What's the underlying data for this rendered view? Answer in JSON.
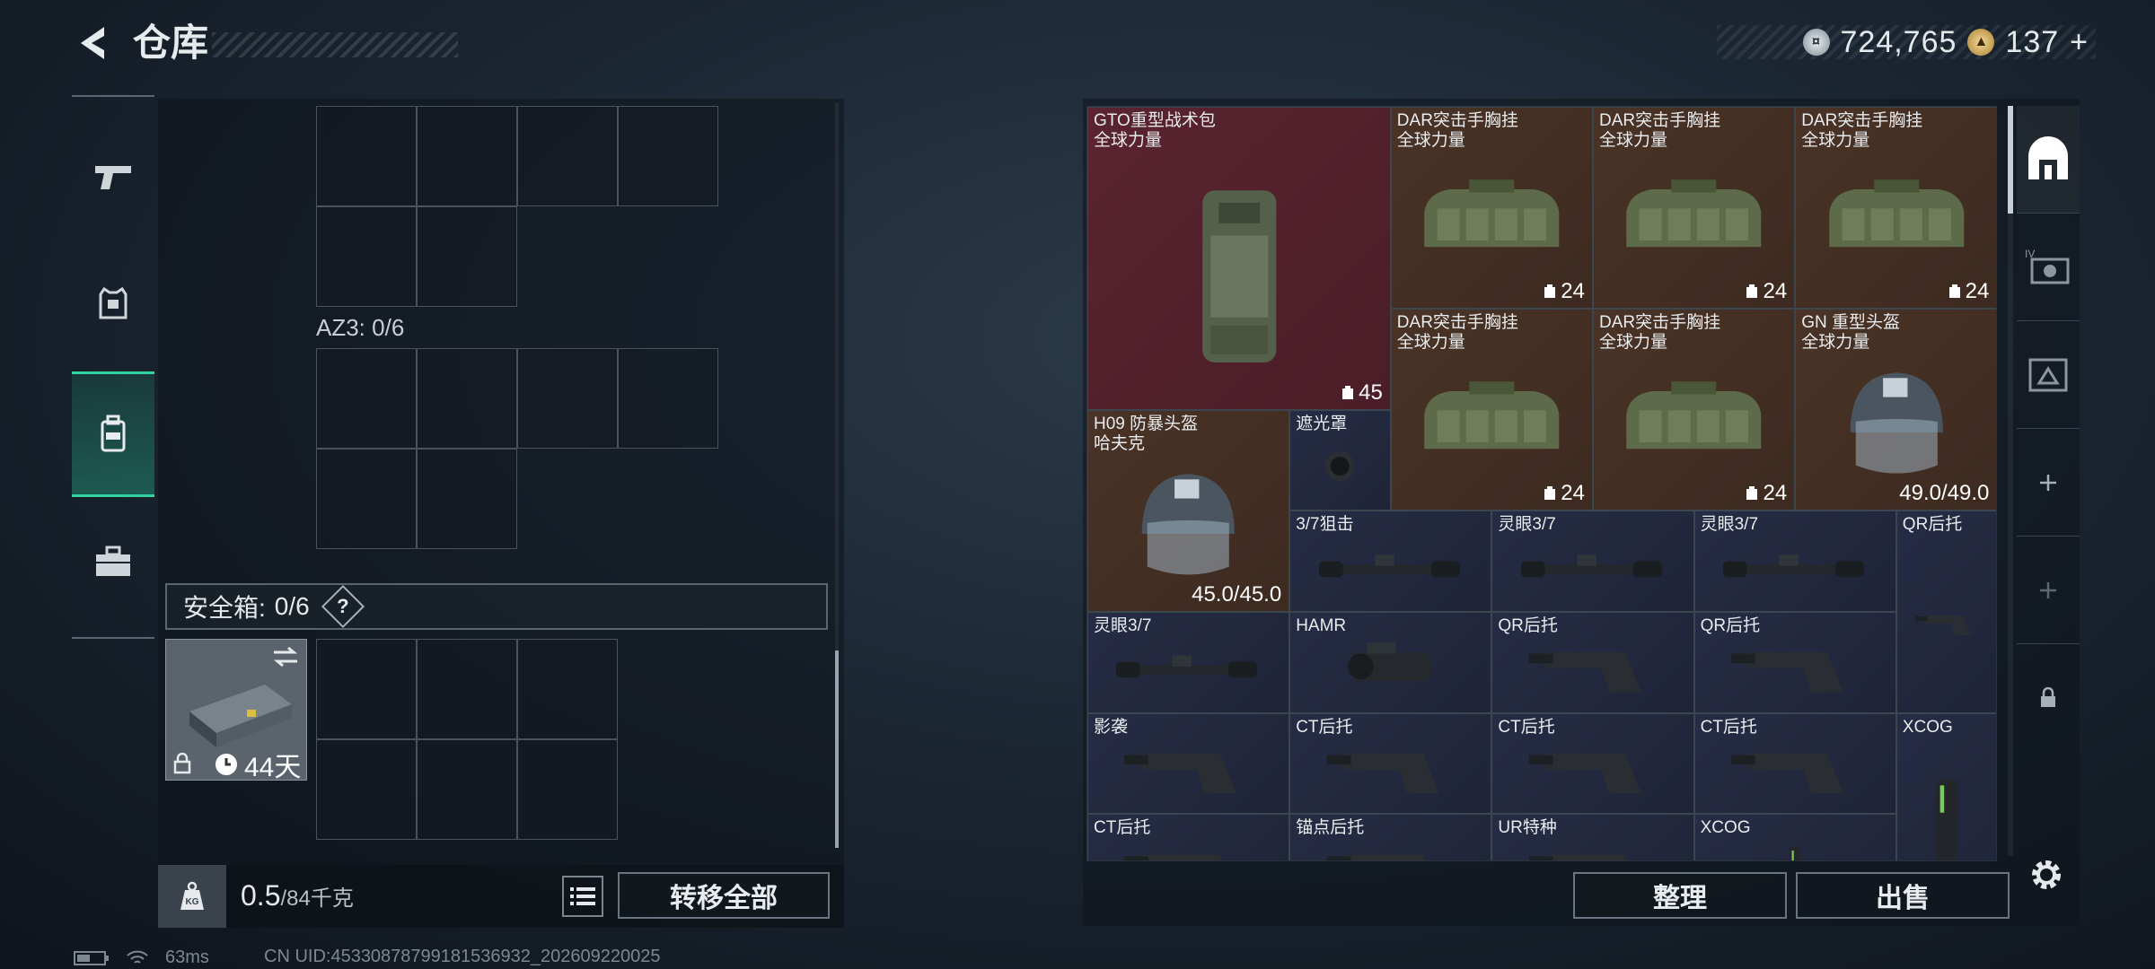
{
  "header": {
    "title": "仓库"
  },
  "currency": {
    "silver": "724,765",
    "gold": "137",
    "gold_plus": "+"
  },
  "nav": {
    "items": [
      "weapons",
      "armor",
      "backpack",
      "briefcase"
    ],
    "active": 2
  },
  "left_panel": {
    "az3_label": "AZ3: 0/6",
    "safe_box": {
      "label": "安全箱:",
      "value": "0/6",
      "help": "?",
      "days": "44天"
    },
    "weight": {
      "value": "0.5",
      "max": "/84千克"
    },
    "transfer_all": "转移全部"
  },
  "inventory": {
    "items": [
      {
        "name": "GTO重型战术包\n全球力量",
        "count": "45",
        "color": "red"
      },
      {
        "name": "DAR突击手胸挂\n全球力量",
        "count": "24",
        "color": "brown"
      },
      {
        "name": "DAR突击手胸挂\n全球力量",
        "count": "24",
        "color": "brown"
      },
      {
        "name": "DAR突击手胸挂\n全球力量",
        "count": "24",
        "color": "brown"
      },
      {
        "name": "DAR突击手胸挂\n全球力量",
        "count": "24",
        "color": "brown"
      },
      {
        "name": "DAR突击手胸挂\n全球力量",
        "count": "24",
        "color": "brown"
      },
      {
        "name": "GN 重型头盔\n全球力量",
        "durability": "49.0/49.0",
        "color": "brown"
      },
      {
        "name": "H09 防暴头盔\n哈夫克",
        "durability": "45.0/45.0",
        "color": "brown"
      },
      {
        "name": "遮光罩",
        "color": "blue"
      },
      {
        "name": "3/7狙击",
        "color": "blue"
      },
      {
        "name": "灵眼3/7",
        "color": "blue"
      },
      {
        "name": "灵眼3/7",
        "color": "blue"
      },
      {
        "name": "QR后托",
        "color": "blue"
      },
      {
        "name": "灵眼3/7",
        "color": "blue"
      },
      {
        "name": "HAMR",
        "color": "blue"
      },
      {
        "name": "QR后托",
        "color": "blue"
      },
      {
        "name": "QR后托",
        "color": "blue"
      },
      {
        "name": "影袭",
        "color": "blue"
      },
      {
        "name": "CT后托",
        "color": "blue"
      },
      {
        "name": "CT后托",
        "color": "blue"
      },
      {
        "name": "CT后托",
        "color": "blue"
      },
      {
        "name": "XCOG",
        "color": "blue"
      },
      {
        "name": "CT后托",
        "color": "blue"
      },
      {
        "name": "锚点后托",
        "color": "blue"
      },
      {
        "name": "UR特种",
        "color": "blue"
      },
      {
        "name": "XCOG",
        "color": "blue"
      }
    ],
    "sort_label": "整理",
    "sell_label": "出售"
  },
  "right_tabs": [
    "home",
    "grade-iv",
    "armor-grade",
    "add",
    "add",
    "lock"
  ],
  "status": {
    "ping": "63ms",
    "uid": "CN UID:45330878799181536932_202609220025"
  },
  "colors": {
    "accent": "#2fd4a0",
    "red_cell": "#5a2430",
    "brown_cell": "#4a3326",
    "blue_cell": "#262c44"
  }
}
